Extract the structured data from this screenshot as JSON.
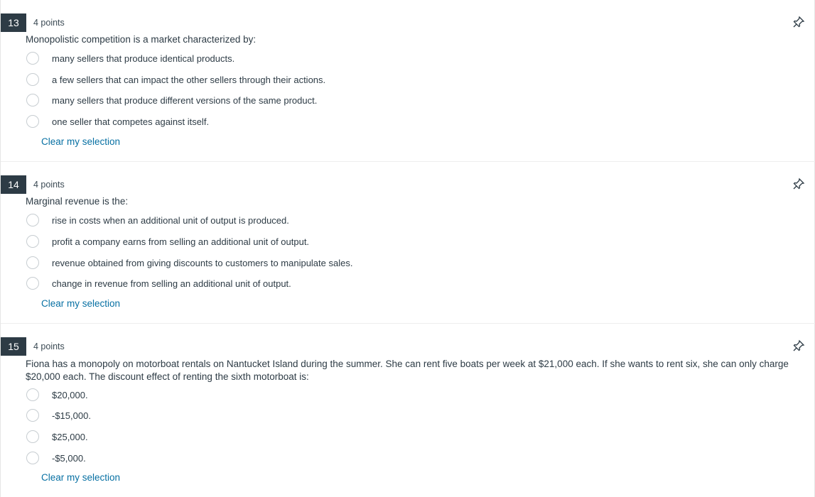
{
  "questions": [
    {
      "number": "13",
      "points": "4 points",
      "text": "Monopolistic competition is a market characterized by:",
      "options": [
        "many sellers that produce identical products.",
        "a few sellers that can impact the other sellers through their actions.",
        "many sellers that produce different versions of the same product.",
        "one seller that competes against itself."
      ],
      "clear_label": "Clear my selection",
      "pin_icon": "pin-icon"
    },
    {
      "number": "14",
      "points": "4 points",
      "text": "Marginal revenue is the:",
      "options": [
        "rise in costs when an additional unit of output is produced.",
        "profit a company earns from selling an additional unit of output.",
        "revenue obtained from giving discounts to customers to manipulate sales.",
        "change in revenue from selling an additional unit of output."
      ],
      "clear_label": "Clear my selection",
      "pin_icon": "pin-icon"
    },
    {
      "number": "15",
      "points": "4 points",
      "text": "Fiona has a monopoly on motorboat rentals on Nantucket Island during the summer. She can rent five boats per week at $21,000 each. If she wants to rent six, she can only charge $20,000 each. The discount effect of renting the sixth motorboat is:",
      "options": [
        "$20,000.",
        "-$15,000.",
        "$25,000.",
        "-$5,000."
      ],
      "clear_label": "Clear my selection",
      "pin_icon": "pin-icon"
    }
  ],
  "colors": {
    "number_badge_bg": "#2d3b45",
    "link": "#0770a3",
    "text": "#2d3b45"
  }
}
